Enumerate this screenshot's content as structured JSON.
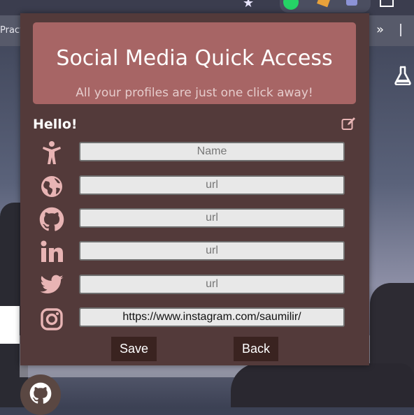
{
  "browser": {
    "bookmark_partial": "Pract",
    "more_glyph": "»"
  },
  "popup": {
    "title": "Social Media Quick Access",
    "subtitle": "All your profiles are just one click away!",
    "greeting": "Hello!",
    "fields": [
      {
        "icon": "person-icon",
        "placeholder": "Name",
        "value": ""
      },
      {
        "icon": "globe-icon",
        "placeholder": "url",
        "value": ""
      },
      {
        "icon": "github-icon",
        "placeholder": "url",
        "value": ""
      },
      {
        "icon": "linkedin-icon",
        "placeholder": "url",
        "value": ""
      },
      {
        "icon": "twitter-icon",
        "placeholder": "url",
        "value": ""
      },
      {
        "icon": "instagram-icon",
        "placeholder": "url",
        "value": "https://www.instagram.com/saumilir/"
      }
    ],
    "save_label": "Save",
    "back_label": "Back"
  },
  "colors": {
    "popup_bg": "#533a3a",
    "banner_bg": "#a76565",
    "icon": "#e8b4b4",
    "button_bg": "#3a2320"
  }
}
